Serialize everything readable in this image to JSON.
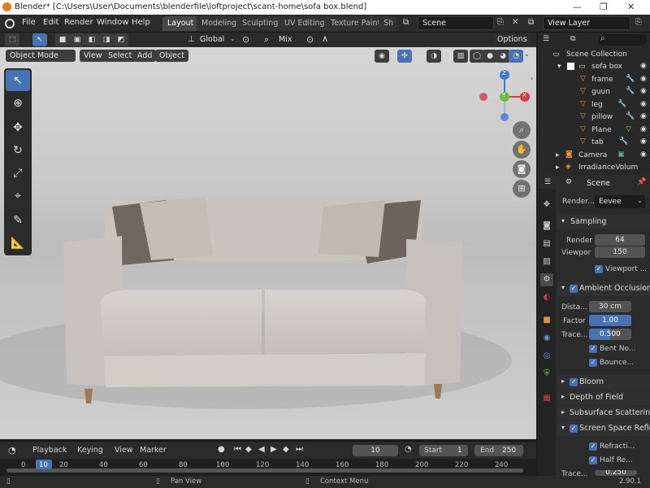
{
  "window": {
    "title": "Blender* [C:\\Users\\User\\Documents\\blenderfile\\loftproject\\scant-home\\sofa box.blend]",
    "min": "—",
    "max": "❐",
    "close": "✕"
  },
  "menu": [
    "File",
    "Edit",
    "Render",
    "Window",
    "Help"
  ],
  "workspaces": [
    "Layout",
    "Modeling",
    "Sculpting",
    "UV Editing",
    "Texture Paint",
    "Sh"
  ],
  "scene": {
    "value": "Scene"
  },
  "view_layer": {
    "value": "View Layer"
  },
  "header3d": {
    "transform_orientation": "Global",
    "pivot": "Mix",
    "options": "Options"
  },
  "viewport": {
    "mode": "Object Mode",
    "menus": [
      "View",
      "Select",
      "Add",
      "Object"
    ],
    "gizmo": {
      "x": "X",
      "y": "Y",
      "z": "Z"
    }
  },
  "outliner": {
    "items": [
      "Scene Collection",
      "sofa box",
      "frame",
      "guun",
      "leg",
      "pillow",
      "Plane",
      "tab",
      "Camera",
      "IrradianceVolum"
    ]
  },
  "properties": {
    "header": "Scene",
    "render_engine_label": "Render...",
    "render_engine": "Eevee",
    "sampling": {
      "title": "Sampling",
      "render_label": "Render",
      "render": "64",
      "viewport_label": "Viewpor",
      "viewport": "150",
      "viewport_denoise": "Viewport ..."
    },
    "ao": {
      "title": "Ambient Occlusion",
      "distance_label": "Dista...",
      "distance": "30 cm",
      "factor_label": "Factor",
      "factor": "1.00",
      "trace_label": "Trace...",
      "trace": "0.500",
      "bent": "Bent No...",
      "bounce": "Bounce..."
    },
    "bloom": "Bloom",
    "dof": "Depth of Field",
    "sss": "Subsurface Scattering",
    "ssr": "Screen Space Refle",
    "refraction": "Refracti...",
    "half_res": "Half Re...",
    "trace_cut_label": "Trace...",
    "trace_cut": "0.250"
  },
  "timeline": {
    "playback": "Playback",
    "keying": "Keying",
    "view": "View",
    "marker": "Marker",
    "current": "10",
    "start_label": "Start",
    "start": "1",
    "end_label": "End",
    "end": "250",
    "ticks": [
      "0",
      "10",
      "20",
      "40",
      "60",
      "80",
      "100",
      "120",
      "140",
      "160",
      "180",
      "200",
      "220",
      "240"
    ]
  },
  "status": {
    "pan": "Pan View",
    "context": "Context Menu",
    "version": "2.90.1"
  }
}
